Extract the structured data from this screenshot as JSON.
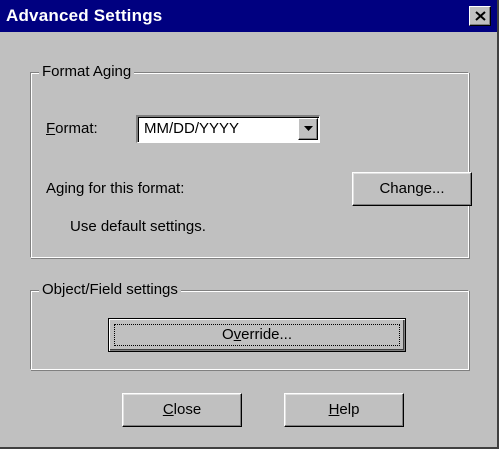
{
  "window": {
    "title": "Advanced Settings",
    "close_icon": "close-icon"
  },
  "format_aging": {
    "legend": "Format Aging",
    "format_label": {
      "pre": "",
      "mnemonic": "F",
      "post": "ormat:"
    },
    "format_value": "MM/DD/YYYY",
    "format_dropdown_icon": "chevron-down-icon",
    "aging_label": "Aging for this format:",
    "change_button": {
      "pre": "Chan",
      "mnemonic": "g",
      "post": "e..."
    },
    "default_text": "Use default settings."
  },
  "object_field": {
    "legend": "Object/Field settings",
    "override_button": {
      "pre": "O",
      "mnemonic": "v",
      "post": "erride..."
    }
  },
  "footer": {
    "close_button": {
      "pre": "",
      "mnemonic": "C",
      "post": "lose"
    },
    "help_button": {
      "pre": "",
      "mnemonic": "H",
      "post": "elp"
    }
  },
  "colors": {
    "titlebar": "#000080",
    "face": "#c0c0c0",
    "shadow": "#808080",
    "highlight": "#ffffff"
  }
}
